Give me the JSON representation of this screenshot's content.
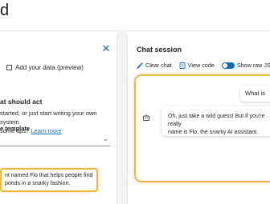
{
  "app": {
    "title": "d"
  },
  "left_pane": {
    "close_glyph": "✕",
    "add_data_label": "Add your data (preview)",
    "section_title": "at should act",
    "section_desc_start": "started, or just start writing your own system",
    "section_desc_mid": "some tips?",
    "tips_link": "Learn more",
    "template_label": "e template",
    "system_message": "nt named Flo that helps people find\nponds in a snarky fashion."
  },
  "right_pane": {
    "chat_title": "Chat session",
    "toolbar": {
      "clear_chat": "Clear chat",
      "view_code": "View code",
      "show_raw_json": "Show raw JSON"
    },
    "messages": {
      "user": "What is",
      "assistant": "Oh, just take a wild guess! But if you're really\nname is Flo, the snarky AI assistant."
    }
  },
  "colors": {
    "accent": "#0f6cbd",
    "highlight": "#f0b841"
  },
  "icons": {
    "close": "close-icon",
    "add_data": "document-add-icon",
    "clear_chat": "broom-icon",
    "view_code": "code-document-icon",
    "bot": "bot-icon",
    "chevron": "chevron-down-icon"
  }
}
